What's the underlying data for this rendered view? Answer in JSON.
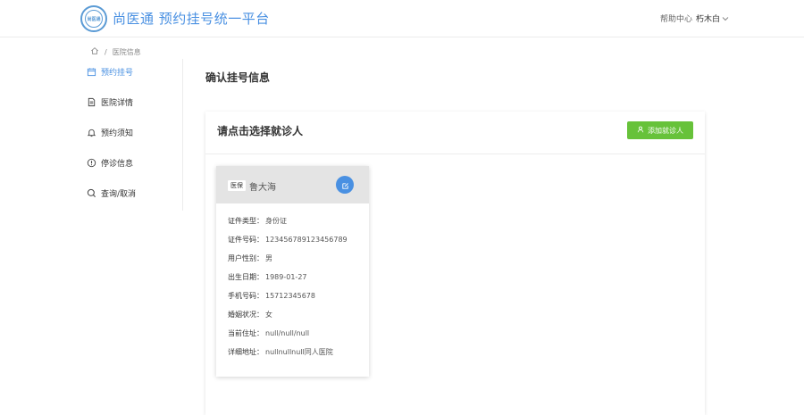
{
  "header": {
    "logo_text": "尚医通",
    "site_title": "尚医通 预约挂号统一平台",
    "help": "帮助中心",
    "user": "朽木白"
  },
  "breadcrumb": {
    "current": "医院信息"
  },
  "sidebar": {
    "items": [
      {
        "label": "预约挂号",
        "icon": "calendar-icon",
        "active": true
      },
      {
        "label": "医院详情",
        "icon": "document-icon",
        "active": false
      },
      {
        "label": "预约须知",
        "icon": "bell-icon",
        "active": false
      },
      {
        "label": "停诊信息",
        "icon": "info-circle-icon",
        "active": false
      },
      {
        "label": "查询/取消",
        "icon": "search-icon",
        "active": false
      }
    ]
  },
  "main": {
    "title": "确认挂号信息",
    "panel_title": "请点击选择就诊人",
    "add_button": "添加就诊人"
  },
  "patient": {
    "tag": "医保",
    "name": "鲁大海",
    "fields": [
      {
        "label": "证件类型：",
        "value": "身份证"
      },
      {
        "label": "证件号码：",
        "value": "123456789123456789"
      },
      {
        "label": "用户性别：",
        "value": "男"
      },
      {
        "label": "出生日期：",
        "value": "1989-01-27"
      },
      {
        "label": "手机号码：",
        "value": "15712345678"
      },
      {
        "label": "婚姻状况：",
        "value": "女"
      },
      {
        "label": "当前住址：",
        "value": "null/null/null"
      },
      {
        "label": "详细地址：",
        "value": "nullnullnull同人医院"
      }
    ]
  },
  "colors": {
    "brand": "#4990e2",
    "success": "#67c23a",
    "card_header": "#e4e4e4"
  }
}
